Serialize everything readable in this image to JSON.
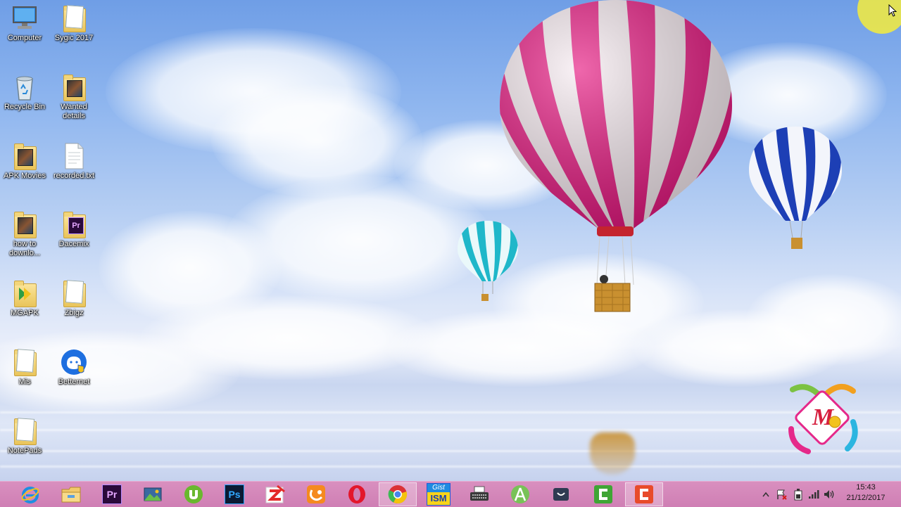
{
  "desktop_icons": [
    {
      "label": "Computer",
      "icon": "computer-icon"
    },
    {
      "label": "Sygic 2017",
      "icon": "folder-icon"
    },
    {
      "label": "Recycle Bin",
      "icon": "recycle-bin-icon"
    },
    {
      "label": "Wanted details",
      "icon": "folder-icon"
    },
    {
      "label": "APK Movies",
      "icon": "folder-icon"
    },
    {
      "label": "recorded.txt",
      "icon": "text-file-icon"
    },
    {
      "label": "how to downlo...",
      "icon": "folder-icon"
    },
    {
      "label": "Dacemix",
      "icon": "premiere-folder-icon"
    },
    {
      "label": "MGAPK",
      "icon": "folder-icon"
    },
    {
      "label": "Zbigz",
      "icon": "folder-icon"
    },
    {
      "label": "Mis",
      "icon": "folder-icon"
    },
    {
      "label": "Betternet",
      "icon": "betternet-icon"
    },
    {
      "label": "NotePads",
      "icon": "folder-icon"
    }
  ],
  "taskbar": {
    "apps": [
      {
        "name": "Internet Explorer",
        "icon": "internet-explorer-icon"
      },
      {
        "name": "File Explorer",
        "icon": "file-explorer-icon"
      },
      {
        "name": "Adobe Premiere",
        "icon": "premiere-icon",
        "text": "Pr"
      },
      {
        "name": "Photos",
        "icon": "photos-icon"
      },
      {
        "name": "uTorrent",
        "icon": "utorrent-icon"
      },
      {
        "name": "Adobe Photoshop",
        "icon": "photoshop-icon",
        "text": "Ps"
      },
      {
        "name": "Zbigz",
        "icon": "zbigz-icon"
      },
      {
        "name": "UC Browser",
        "icon": "uc-browser-icon"
      },
      {
        "name": "Opera",
        "icon": "opera-icon"
      },
      {
        "name": "Google Chrome",
        "icon": "chrome-icon"
      },
      {
        "name": "Gist ISM",
        "icon": "gist-ism-icon",
        "text_top": "Gist",
        "text_bottom": "ISM"
      },
      {
        "name": "Typewriter",
        "icon": "typewriter-icon"
      },
      {
        "name": "Android Studio",
        "icon": "android-studio-icon"
      },
      {
        "name": "Webcam App",
        "icon": "webcam-icon"
      },
      {
        "name": "Camtasia",
        "icon": "camtasia-green-icon"
      },
      {
        "name": "Camtasia Recorder",
        "icon": "camtasia-recorder-icon"
      }
    ],
    "tray_icons": [
      "show-hidden-icons-icon",
      "action-center-flag-icon",
      "power-icon",
      "network-signal-icon",
      "volume-icon"
    ],
    "clock": {
      "time": "15:43",
      "date": "21/12/2017"
    }
  },
  "watermark": {
    "icon": "movies-corner-logo-icon",
    "letter": "M"
  },
  "colors": {
    "taskbar": "#d28ab9",
    "sky_top": "#6f9ee6",
    "balloon_pink": "#e6157f",
    "balloon_blue": "#1d3fb5",
    "balloon_teal": "#1fb7c9"
  }
}
